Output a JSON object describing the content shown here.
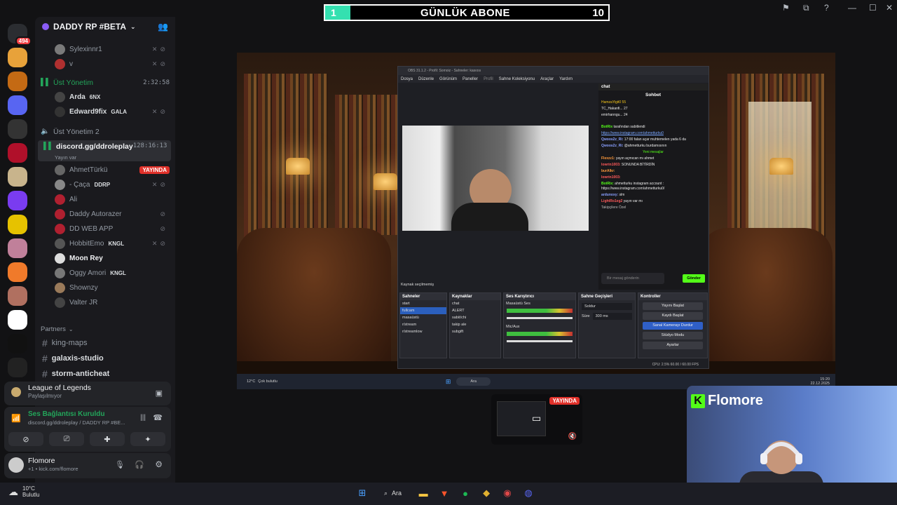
{
  "server_rail": {
    "items": [
      {
        "icon": "discord-home-icon",
        "badge": "494",
        "color": "#2b2d31"
      },
      {
        "icon": "server-cat-icon",
        "color": "#e8a23a"
      },
      {
        "icon": "server-lion-icon",
        "color": "#c46a14"
      },
      {
        "icon": "server-folder-icon",
        "color": "#5865f2"
      },
      {
        "icon": "server-dark-icon",
        "color": "#333"
      },
      {
        "icon": "server-red-icon",
        "color": "#b0102a"
      },
      {
        "icon": "server-tan-icon",
        "color": "#c8b48c"
      },
      {
        "icon": "server-purple-icon",
        "color": "#7a3cf0"
      },
      {
        "icon": "server-yellow-icon",
        "color": "#e6c200"
      },
      {
        "icon": "server-anime-icon",
        "color": "#c0809a"
      },
      {
        "icon": "server-fox-icon",
        "color": "#f07a2a"
      },
      {
        "icon": "server-girl-icon",
        "color": "#b07060"
      },
      {
        "icon": "server-a-icon",
        "color": "#ffffff"
      },
      {
        "icon": "server-mnq-icon",
        "color": "#111"
      },
      {
        "icon": "server-bird-icon",
        "color": "#222"
      },
      {
        "icon": "server-hand-icon",
        "color": "#a06040"
      }
    ]
  },
  "guild": {
    "name": "DADDY RP #BETA"
  },
  "members_top": [
    {
      "name": "Sylexinnr1"
    },
    {
      "name": "v"
    }
  ],
  "voice_channels": {
    "ust_yonetim": {
      "name": "Üst Yönetim",
      "time": "2:32:58"
    },
    "ust_yonetim_members": [
      {
        "name": "Arda",
        "tag": "6NX"
      },
      {
        "name": "Edward9fix",
        "tag": "GALA"
      }
    ],
    "ust_yonetim_2": {
      "name": "Üst Yönetim 2"
    },
    "discord_channel": {
      "name": "discord.gg/ddroleplay",
      "time": "128:16:13",
      "status": "Yayın var"
    },
    "discord_members": [
      {
        "name": "AhmetTürkü",
        "live": "YAYINDA"
      },
      {
        "name": "- Çaça",
        "tag": "DDRP"
      },
      {
        "name": "Ali"
      },
      {
        "name": "Daddy Autorazer"
      },
      {
        "name": "DD WEB APP"
      },
      {
        "name": "HobbitEmo",
        "tag": "KNGL"
      },
      {
        "name": "Moon Rey"
      },
      {
        "name": "Oggy Amori",
        "tag": "KNGL"
      },
      {
        "name": "Shownzy"
      },
      {
        "name": "Valter JR"
      }
    ]
  },
  "category": {
    "name": "Partners"
  },
  "text_channels": [
    {
      "name": "king-maps"
    },
    {
      "name": "galaxis-studio"
    },
    {
      "name": "storm-anticheat"
    }
  ],
  "activity": {
    "game": "League of Legends",
    "status": "Paylaşılmıyor"
  },
  "voice_connection": {
    "title": "Ses Bağlantısı Kuruldu",
    "detail": "discord.gg/ddroleplay / DADDY RP #BE..."
  },
  "user": {
    "name": "Flomore",
    "status": "+1 • kick.com/flomore"
  },
  "banner": {
    "progress": "1",
    "title": "GÜNLÜK ABONE",
    "goal": "10"
  },
  "obs": {
    "title": "OBS 31.1.2 - Profil: Somoiz - Sahneler: kasıosı",
    "menu": [
      "Dosya",
      "Düzenle",
      "Görünüm",
      "Paneller",
      "Profil",
      "Sahne Koleksiyonu",
      "Araçlar",
      "Yardım"
    ],
    "no_source": "Kaynak seçilmemiş",
    "scenes_title": "Sahneler",
    "scenes": [
      "start",
      "fullcam",
      "masaüstü",
      "r/stream",
      "r/streamlow"
    ],
    "sources_title": "Kaynaklar",
    "sources": [
      "chat",
      "ALERT",
      "sabit/chi",
      "takip ale",
      "subgift"
    ],
    "mixer_title": "Ses Karıştırıcı",
    "mixer": [
      "Masaüstü Ses",
      "Mic/Aux"
    ],
    "transitions_title": "Sahne Geçişleri",
    "transition_type": "Soldur",
    "duration_label": "Süre",
    "duration": "300 ms",
    "controls_title": "Kontroller",
    "controls": [
      "Yayını Başlat",
      "Kaydı Başlat",
      "Sanal Kamerayı Durdur",
      "Stüdyo Modu",
      "Ayarlar"
    ],
    "status": "CPU: 2.5%     60.00 / 60.00 FPS",
    "chat_tab": "chat",
    "chat_header": "Sohbet",
    "chat_top": [
      "HamzaYigit0  55",
      "TC_Hakanfi... 27",
      "emirhanngu... 24"
    ],
    "chat_messages": [
      {
        "n": "BotRix",
        "t": "tarafından sabitlendi"
      },
      {
        "n": "",
        "t": "https://www.instagram.com/ahmetturku0"
      },
      {
        "n": "Qwoos2z_Ri:",
        "t": "17:00 falan açar muhtemelen yada 6 da"
      },
      {
        "n": "Qwoos2z_Ri:",
        "t": "@ahmetturku burdamısının"
      },
      {
        "n": "",
        "t": "Yeni mesajlar"
      },
      {
        "n": "Flexzz1:",
        "t": "yayın açmıcan mı ahmet"
      },
      {
        "n": "lowrin1003:",
        "t": "SONUNDA BİTİRDİN"
      },
      {
        "n": "burAlkr:",
        "t": ""
      },
      {
        "n": "lowrin1003:",
        "t": ""
      },
      {
        "n": "BotRix:",
        "t": "ahmetturku instagram account : https://www.instagram.com/ahmetturku0/"
      },
      {
        "n": "ardunoxy:",
        "t": "slm"
      },
      {
        "n": "LightRo1eg2",
        "t": "yayın var mı"
      }
    ],
    "chat_followers": "Takipçilere Özel",
    "chat_placeholder": "Bir mesaj gönderin",
    "chat_send": "Gönder"
  },
  "inner_taskbar": {
    "weather": "12°C",
    "weather_desc": "Çok bulutlu",
    "search": "Ara",
    "time": "15:20",
    "date": "22.12.2025"
  },
  "share": {
    "live": "YAYINDA"
  },
  "cam": {
    "brand": "Flomore",
    "k": "K"
  },
  "taskbar": {
    "temp": "10°C",
    "desc": "Bulutlu",
    "search": "Ara"
  },
  "colors": {
    "accent_green": "#23a55a",
    "live_red": "#e0312a",
    "kick_green": "#53fc18"
  }
}
